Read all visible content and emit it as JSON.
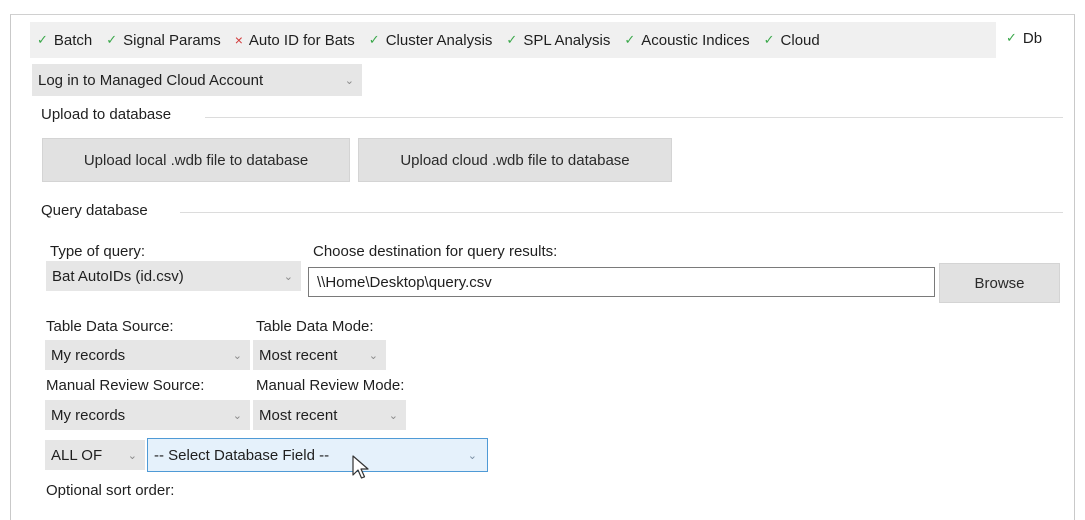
{
  "tabs": [
    {
      "label": "Batch",
      "status": "ok"
    },
    {
      "label": "Signal Params",
      "status": "ok"
    },
    {
      "label": "Auto ID for Bats",
      "status": "error"
    },
    {
      "label": "Cluster Analysis",
      "status": "ok"
    },
    {
      "label": "SPL Analysis",
      "status": "ok"
    },
    {
      "label": "Acoustic Indices",
      "status": "ok"
    },
    {
      "label": "Cloud",
      "status": "ok"
    }
  ],
  "active_tab": {
    "label": "Db",
    "status": "ok"
  },
  "status_marks": {
    "ok": "✓",
    "error": "×"
  },
  "account_select": {
    "value": "Log in to Managed Cloud Account"
  },
  "upload": {
    "group_label": "Upload to database",
    "local_button": "Upload local .wdb file to database",
    "cloud_button": "Upload cloud .wdb file to database"
  },
  "query": {
    "group_label": "Query database",
    "type_label": "Type of query:",
    "type_value": "Bat AutoIDs (id.csv)",
    "dest_label": "Choose destination for query results:",
    "dest_value": "\\\\Home\\Desktop\\query.csv",
    "browse_button": "Browse",
    "table_source_label": "Table Data Source:",
    "table_source_value": "My records",
    "table_mode_label": "Table Data Mode:",
    "table_mode_value": "Most recent",
    "review_source_label": "Manual Review Source:",
    "review_source_value": "My records",
    "review_mode_label": "Manual Review Mode:",
    "review_mode_value": "Most recent",
    "logic_value": "ALL OF",
    "field_value": "-- Select Database Field --",
    "sort_label": "Optional sort order:"
  },
  "icons": {
    "chevron": "chevron-down-icon",
    "pointer": "mouse-pointer-icon"
  },
  "colors": {
    "ok": "#3aa84a",
    "error": "#d23a3a",
    "focus_border": "#4f9ad6",
    "focus_fill": "#e5f1fb"
  }
}
